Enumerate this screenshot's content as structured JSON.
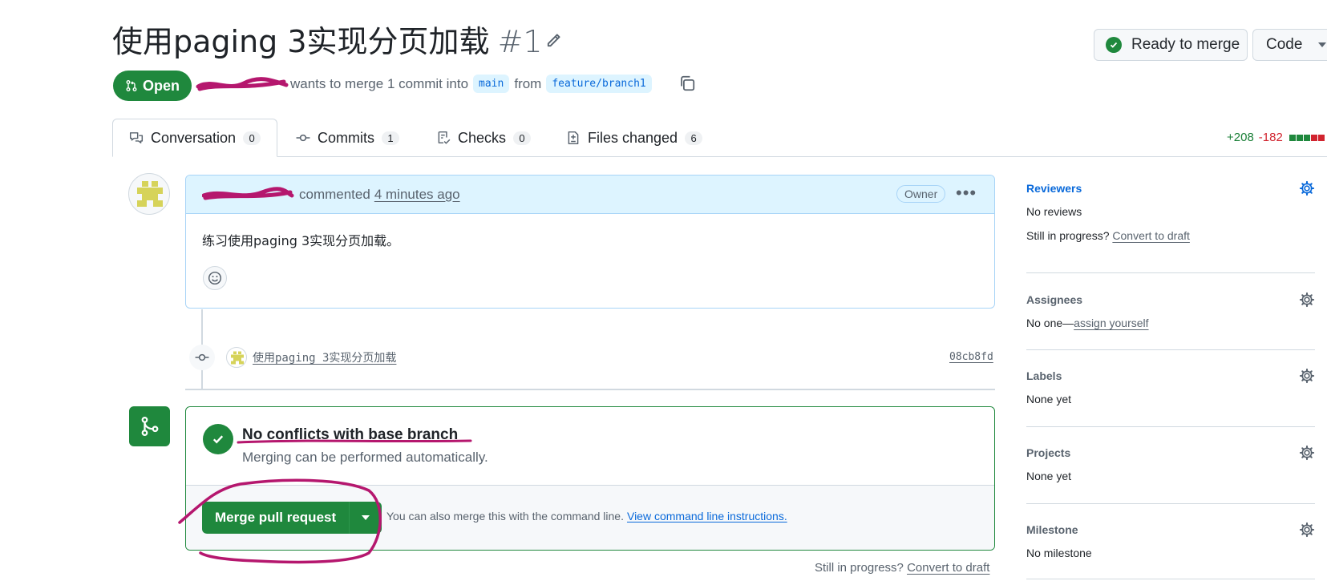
{
  "header": {
    "title": "使用paging 3实现分页加载",
    "number": "#1",
    "ready_label": "Ready to merge",
    "code_label": "Code"
  },
  "pr_meta": {
    "state": "Open",
    "text_before": "wants to merge 1 commit into",
    "base_branch": "main",
    "from_text": "from",
    "head_branch": "feature/branch1"
  },
  "tabs": [
    {
      "label": "Conversation",
      "count": "0"
    },
    {
      "label": "Commits",
      "count": "1"
    },
    {
      "label": "Checks",
      "count": "0"
    },
    {
      "label": "Files changed",
      "count": "6"
    }
  ],
  "diffstat": {
    "additions": "+208",
    "deletions": "-182"
  },
  "comment": {
    "action": "commented",
    "time": "4 minutes ago",
    "role_badge": "Owner",
    "body": "练习使用paging 3实现分页加载。"
  },
  "commit": {
    "message": "使用paging 3实现分页加载",
    "sha": "08cb8fd"
  },
  "merge": {
    "title": "No conflicts with base branch",
    "subtitle": "Merging can be performed automatically.",
    "button_label": "Merge pull request",
    "note": "You can also merge this with the command line.",
    "note_link": "View command line instructions."
  },
  "bottom": {
    "text": "Still in progress?",
    "link": "Convert to draft"
  },
  "sidebar": {
    "reviewers": {
      "title": "Reviewers",
      "value": "No reviews",
      "progress_text": "Still in progress?",
      "progress_link": "Convert to draft"
    },
    "assignees": {
      "title": "Assignees",
      "value": "No one—",
      "link": "assign yourself"
    },
    "labels": {
      "title": "Labels",
      "value": "None yet"
    },
    "projects": {
      "title": "Projects",
      "value": "None yet"
    },
    "milestone": {
      "title": "Milestone",
      "value": "No milestone"
    }
  },
  "colors": {
    "success": "#1f883d",
    "accent_blue": "#0969da",
    "danger": "#d1242f",
    "annotation": "#b5176e"
  }
}
